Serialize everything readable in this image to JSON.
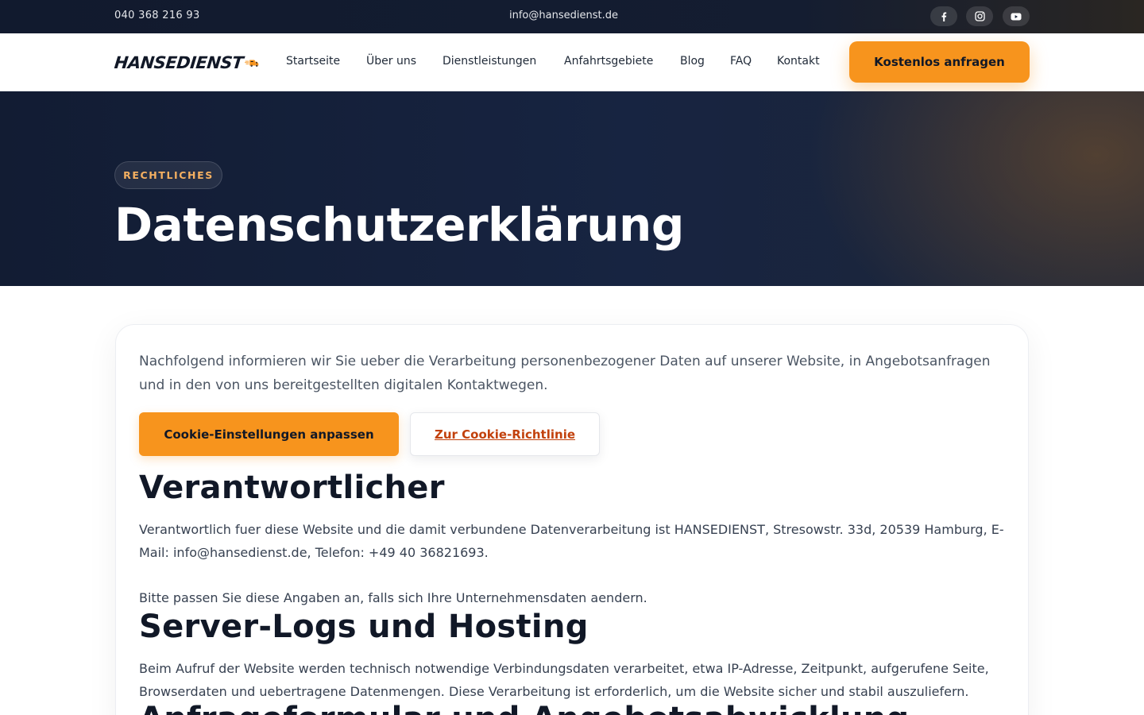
{
  "topbar": {
    "phone": "040 368 216 93",
    "email": "info@hansedienst.de",
    "social": [
      "facebook-icon",
      "instagram-icon",
      "youtube-icon"
    ]
  },
  "nav": {
    "logo_text": "HANSEDIENST",
    "links": [
      "Startseite",
      "Über uns",
      "Dienstleistungen",
      "Anfahrtsgebiete",
      "Blog",
      "FAQ",
      "Kontakt"
    ],
    "cta": "Kostenlos anfragen"
  },
  "hero": {
    "badge": "RECHTLICHES",
    "title": "Datenschutzerklärung"
  },
  "content": {
    "intro": "Nachfolgend informieren wir Sie ueber die Verarbeitung personenbezogener Daten auf unserer Website, in Angebotsanfragen und in den von uns bereitgestellten digitalen Kontaktwegen.",
    "btn_cookie_settings": "Cookie-Einstellungen anpassen",
    "btn_cookie_policy": "Zur Cookie-Richtlinie",
    "sections": [
      {
        "heading": "Verantwortlicher",
        "p1": "Verantwortlich fuer diese Website und die damit verbundene Datenverarbeitung ist HANSEDIENST, Stresowstr. 33d, 20539 Hamburg, E-Mail: info@hansedienst.de, Telefon: +49 40 36821693.",
        "p2": "Bitte passen Sie diese Angaben an, falls sich Ihre Unternehmensdaten aendern."
      },
      {
        "heading": "Server-Logs und Hosting",
        "p1": "Beim Aufruf der Website werden technisch notwendige Verbindungsdaten verarbeitet, etwa IP-Adresse, Zeitpunkt, aufgerufene Seite, Browserdaten und uebertragene Datenmengen. Diese Verarbeitung ist erforderlich, um die Website sicher und stabil auszuliefern."
      },
      {
        "heading": "Anfrageformular und Angebotsabwicklung"
      }
    ]
  },
  "colors": {
    "accent": "#f7941d",
    "link": "#c2410c",
    "dark_navy": "#121c33"
  }
}
